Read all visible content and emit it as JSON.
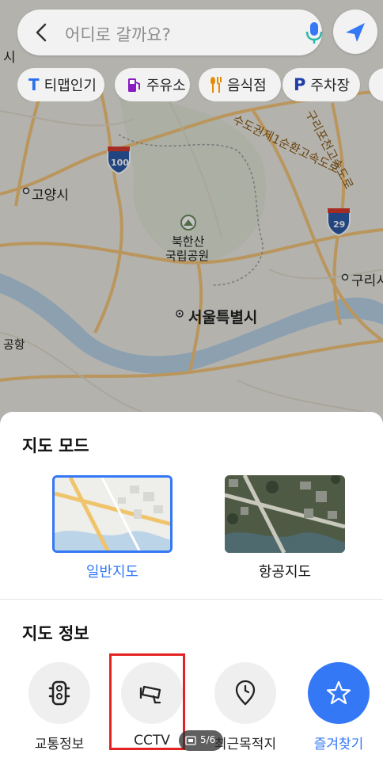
{
  "search": {
    "placeholder": "어디로 갈까요?"
  },
  "chips": [
    {
      "label": "티맵인기",
      "icon": "tmap-logo-icon"
    },
    {
      "label": "주유소",
      "icon": "gas-station-icon"
    },
    {
      "label": "음식점",
      "icon": "restaurant-icon"
    },
    {
      "label": "주차장",
      "icon": "parking-icon"
    }
  ],
  "map_labels": {
    "goyang": "고양시",
    "bukhansan": "북한산",
    "park": "국립공원",
    "seoul": "서울특별시",
    "guri": "구리시",
    "si": "시",
    "airport": "공항",
    "ring_road": "수도권제1순환고속도로",
    "guri_pocheon": "구리포천고속도로",
    "route_100": "100",
    "route_29": "29"
  },
  "map_mode": {
    "title": "지도 모드",
    "general": "일반지도",
    "aerial": "항공지도"
  },
  "map_info": {
    "title": "지도 정보",
    "traffic": "교통정보",
    "cctv": "CCTV",
    "recent": "최근목적지",
    "favorites": "즐겨찾기"
  },
  "pager": "5/6",
  "colors": {
    "accent": "#3478f6",
    "highlight": "#e32222"
  }
}
